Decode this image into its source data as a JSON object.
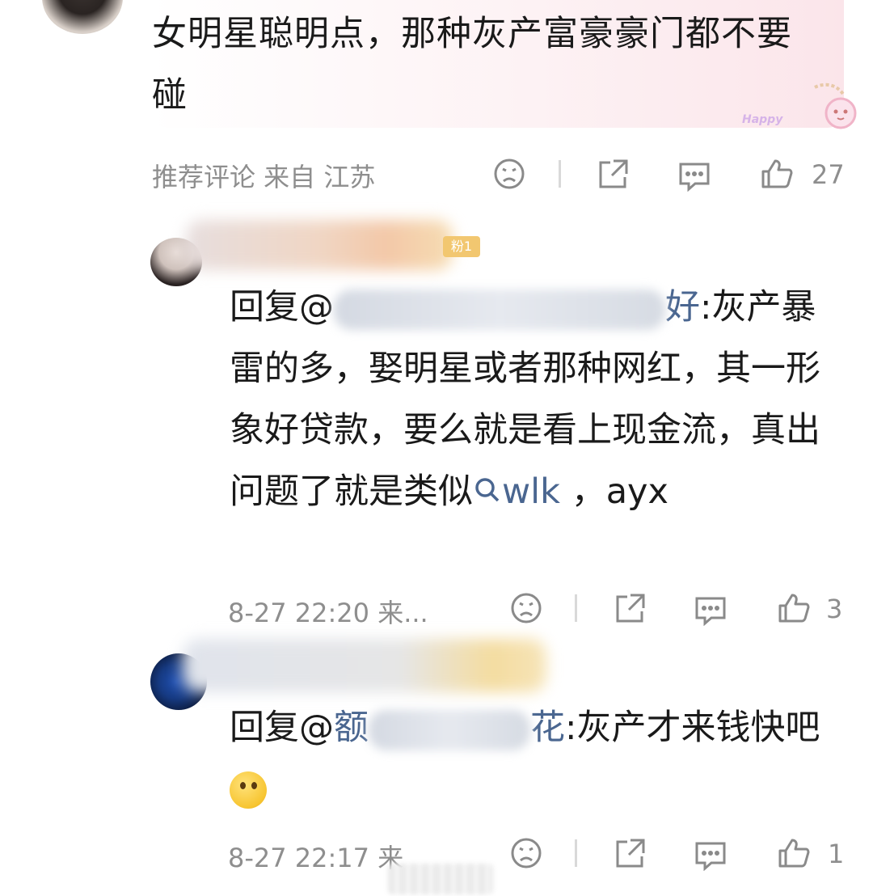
{
  "top_comment": {
    "text": "女明星聪明点，那种灰产富豪豪门都不要碰",
    "meta": "推荐评论 来自 江苏",
    "deco_text": "Happy",
    "like_count": "27"
  },
  "replies": [
    {
      "badge": "粉1",
      "prefix": "回复@",
      "mention_end": "好",
      "body": ":灰产暴雷的多，娶明星或者那种网红，其一形象好贷款，要么就是看上现金流，真出问题了就是类似",
      "link_icon": "search-icon",
      "link_text": "wlk",
      "tail": " ，ayx",
      "time": "8-27 22:20 来...",
      "like_count": "3"
    },
    {
      "prefix": "回复@",
      "mention_start": "额",
      "mention_end": "花",
      "body": ":灰产才来钱快吧",
      "emoji": "thinking-face-emoji",
      "time": "8-27 22:17 来",
      "like_count": "1"
    }
  ],
  "colors": {
    "meta_gray": "#8e8e8e",
    "mention_blue": "#4a6690",
    "text": "#1a1a1a"
  }
}
